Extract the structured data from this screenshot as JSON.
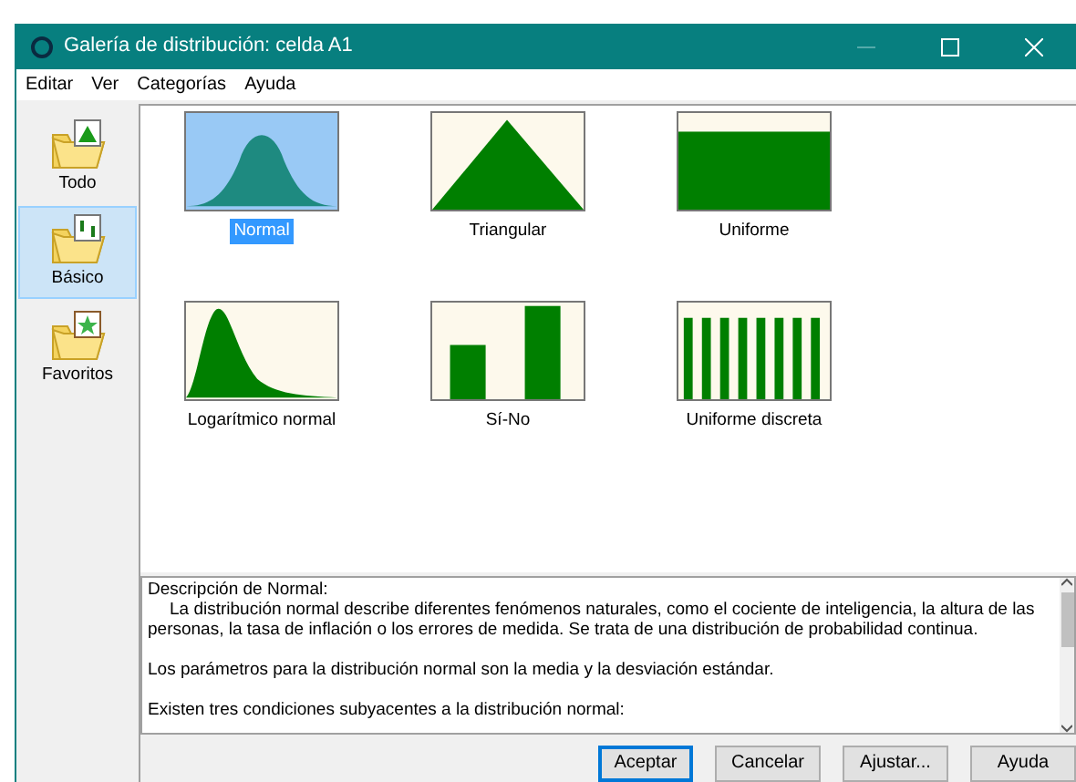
{
  "window": {
    "title": "Galería de distribución: celda A1"
  },
  "menu": [
    "Editar",
    "Ver",
    "Categorías",
    "Ayuda"
  ],
  "sidebar": {
    "items": [
      {
        "label": "Todo",
        "kind": "all",
        "selected": false
      },
      {
        "label": "Básico",
        "kind": "basic",
        "selected": true
      },
      {
        "label": "Favoritos",
        "kind": "favorites",
        "selected": false
      }
    ]
  },
  "gallery": {
    "items": [
      {
        "label": "Normal",
        "kind": "normal",
        "selected": true
      },
      {
        "label": "Triangular",
        "kind": "triangular",
        "selected": false
      },
      {
        "label": "Uniforme",
        "kind": "uniform",
        "selected": false
      },
      {
        "label": "Logarítmico normal",
        "kind": "lognormal",
        "selected": false
      },
      {
        "label": "Sí-No",
        "kind": "yesno",
        "selected": false
      },
      {
        "label": "Uniforme discreta",
        "kind": "discrete",
        "selected": false
      }
    ]
  },
  "description": {
    "title": "Descripción de Normal:",
    "paragraphs": [
      {
        "text": "La distribución normal describe diferentes fenómenos naturales, como el cociente de inteligencia, la altura de las personas, la tasa de inflación o los errores de medida. Se trata de una distribución de probabilidad continua.",
        "indented": true
      },
      {
        "text": "Los parámetros para la distribución normal son la media y la desviación estándar.",
        "indented": false
      },
      {
        "text": "Existen tres condiciones subyacentes a la distribución normal:",
        "indented": false
      }
    ]
  },
  "buttons": [
    {
      "label": "Aceptar",
      "default": true
    },
    {
      "label": "Cancelar",
      "default": false
    },
    {
      "label": "Ajustar...",
      "default": false
    },
    {
      "label": "Ayuda",
      "default": false
    }
  ]
}
